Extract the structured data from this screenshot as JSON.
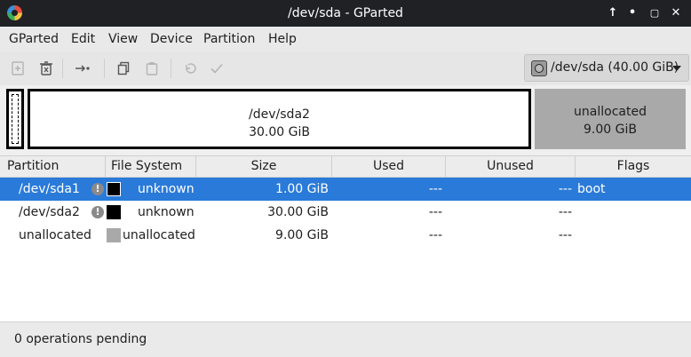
{
  "window": {
    "title": "/dev/sda - GParted"
  },
  "menubar": {
    "items": [
      "GParted",
      "Edit",
      "View",
      "Device",
      "Partition",
      "Help"
    ]
  },
  "toolbar": {
    "icons": [
      "new-icon",
      "delete-icon",
      "resize-move-icon",
      "copy-icon",
      "paste-icon",
      "undo-icon",
      "apply-icon"
    ]
  },
  "device_selector": {
    "label": "/dev/sda (40.00 GiB)"
  },
  "diskmap": {
    "sda2": {
      "name": "/dev/sda2",
      "size": "30.00 GiB"
    },
    "unallocated": {
      "name": "unallocated",
      "size": "9.00 GiB"
    }
  },
  "table": {
    "headers": [
      "Partition",
      "File System",
      "Size",
      "Used",
      "Unused",
      "Flags"
    ],
    "rows": [
      {
        "partition": "/dev/sda1",
        "filesystem": "unknown",
        "size": "1.00 GiB",
        "used": "---",
        "unused": "---",
        "flags": "boot",
        "selected": true
      },
      {
        "partition": "/dev/sda2",
        "filesystem": "unknown",
        "size": "30.00 GiB",
        "used": "---",
        "unused": "---",
        "flags": "",
        "selected": false
      },
      {
        "partition": "unallocated",
        "filesystem": "unallocated",
        "size": "9.00 GiB",
        "used": "---",
        "unused": "---",
        "flags": "",
        "selected": false
      }
    ]
  },
  "status": {
    "text": "0 operations pending"
  },
  "colors": {
    "selection": "#2a7ad9",
    "titlebar": "#1f2124",
    "unallocated": "#a9a9a9"
  }
}
